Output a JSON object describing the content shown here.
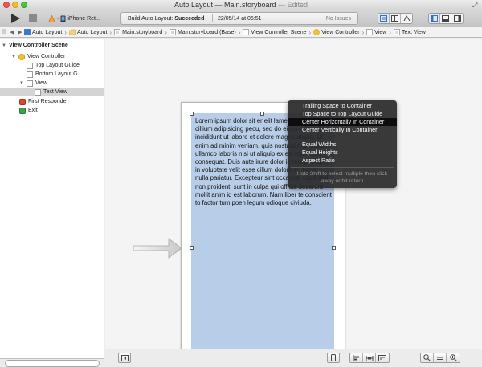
{
  "window": {
    "title_main": "Auto Layout — ",
    "title_file": "Main.storyboard",
    "title_state": " — Edited"
  },
  "toolbar": {
    "scheme_target": "iPhone Ret...",
    "status_prefix": "Build Auto Layout: ",
    "status_result": "Succeeded",
    "timestamp": "22/05/14 at 06:51",
    "issues": "No Issues"
  },
  "jumpbar": {
    "crumbs": [
      "Auto Layout",
      "Auto Layout",
      "Main.storyboard",
      "Main.storyboard (Base)",
      "View Controller Scene",
      "View Controller",
      "View",
      "Text View"
    ]
  },
  "outline": {
    "items": [
      {
        "label": "View Controller Scene"
      },
      {
        "label": "View Controller"
      },
      {
        "label": "Top Layout Guide"
      },
      {
        "label": "Bottom Layout G..."
      },
      {
        "label": "View"
      },
      {
        "label": "Text View"
      },
      {
        "label": "First Responder"
      },
      {
        "label": "Exit"
      }
    ]
  },
  "canvas": {
    "text_view_content": "Lorem ipsum dolor sit er elit lamet, consectetaur cillium adipisicing pecu, sed do eiusmod tempor incididunt ut labore et dolore magna aliqua. Ut enim ad minim veniam, quis nostrud exercitation ullamco laboris nisi ut aliquip ex ea commodo consequat. Duis aute irure dolor in reprehenderit in voluptate velit esse cillum dolore eu fugiat nulla pariatur. Excepteur sint occaecat cupidatat non proident, sunt in culpa qui officia deserunt mollit anim id est laborum. Nam liber te conscient to factor tum poen legum odioque civiuda."
  },
  "popup": {
    "items": [
      "Trailing Space to Container",
      "Top Space to Top Layout Guide",
      "Center Horizontally In Container",
      "Center Vertically In Container",
      "Equal Widths",
      "Equal Heights",
      "Aspect Ratio"
    ],
    "highlighted_index": 2,
    "hint": "Hold Shift to select multiple then click away or hit return"
  },
  "colors": {
    "text_view_fill": "#b8cde8",
    "popup_bg": "#282828"
  }
}
